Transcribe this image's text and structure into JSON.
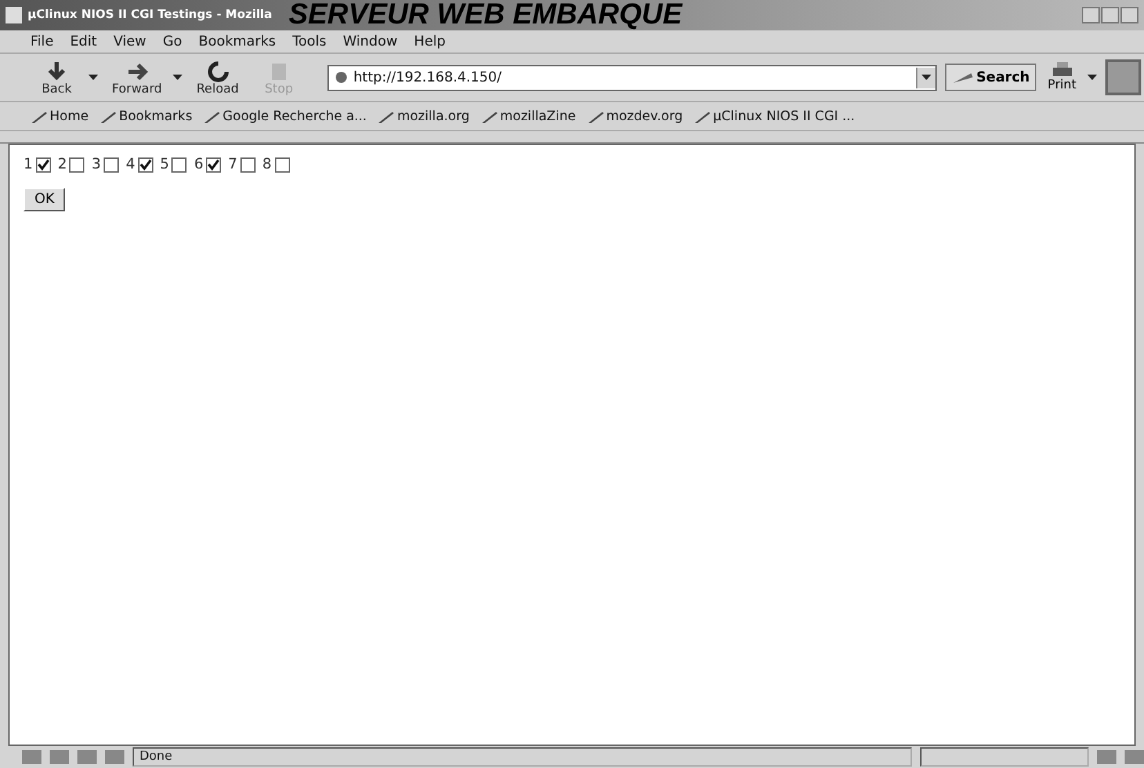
{
  "window": {
    "title": "µClinux NIOS II CGI Testings - Mozilla",
    "caption": "SERVEUR WEB EMBARQUE"
  },
  "menu": [
    "File",
    "Edit",
    "View",
    "Go",
    "Bookmarks",
    "Tools",
    "Window",
    "Help"
  ],
  "toolbar": {
    "buttons": [
      {
        "label": "Back",
        "disabled": false,
        "dropdown": true
      },
      {
        "label": "Forward",
        "disabled": false,
        "dropdown": true
      },
      {
        "label": "Reload",
        "disabled": false,
        "dropdown": false
      },
      {
        "label": "Stop",
        "disabled": true,
        "dropdown": false
      }
    ],
    "address": "http://192.168.4.150/",
    "search": "Search",
    "print": "Print"
  },
  "bookmarks": [
    "Home",
    "Bookmarks",
    "Google Recherche a...",
    "mozilla.org",
    "mozillaZine",
    "mozdev.org",
    "µClinux NIOS II CGI ..."
  ],
  "checkboxes": [
    {
      "label": "1",
      "checked": true
    },
    {
      "label": "2",
      "checked": false
    },
    {
      "label": "3",
      "checked": false
    },
    {
      "label": "4",
      "checked": true
    },
    {
      "label": "5",
      "checked": false
    },
    {
      "label": "6",
      "checked": true
    },
    {
      "label": "7",
      "checked": false
    },
    {
      "label": "8",
      "checked": false
    }
  ],
  "submit": "OK",
  "status_bar": {
    "text": "Done"
  }
}
